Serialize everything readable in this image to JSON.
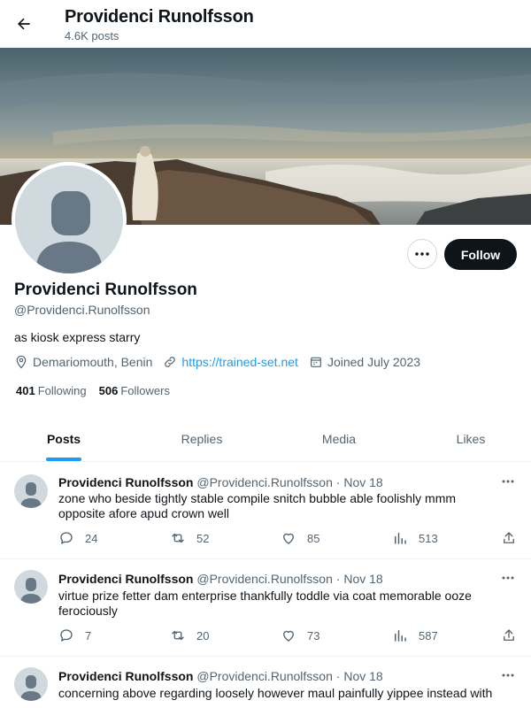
{
  "header": {
    "back_icon": "arrow-left-icon",
    "title": "Providenci Runolfsson",
    "posts_count": "4.6K posts"
  },
  "profile": {
    "name": "Providenci Runolfsson",
    "handle": "@Providenci.Runolfsson",
    "bio": "as kiosk express starry",
    "location": "Demariomouth, Benin",
    "link": "https://trained-set.net",
    "joined": "Joined July 2023",
    "following_count": "401",
    "following_label": "Following",
    "followers_count": "506",
    "followers_label": "Followers",
    "follow_label": "Follow"
  },
  "tabs": [
    {
      "label": "Posts",
      "active": true
    },
    {
      "label": "Replies",
      "active": false
    },
    {
      "label": "Media",
      "active": false
    },
    {
      "label": "Likes",
      "active": false
    }
  ],
  "posts": [
    {
      "name": "Providenci Runolfsson",
      "handle": "@Providenci.Runolfsson",
      "date": "Nov 18",
      "text": "zone who beside tightly stable compile snitch bubble able foolishly mmm opposite afore apud crown well",
      "replies": "24",
      "reposts": "52",
      "likes": "85",
      "views": "513"
    },
    {
      "name": "Providenci Runolfsson",
      "handle": "@Providenci.Runolfsson",
      "date": "Nov 18",
      "text": "virtue prize fetter dam enterprise thankfully toddle via coat memorable ooze ferociously",
      "replies": "7",
      "reposts": "20",
      "likes": "73",
      "views": "587"
    },
    {
      "name": "Providenci Runolfsson",
      "handle": "@Providenci.Runolfsson",
      "date": "Nov 18",
      "text": "concerning above regarding loosely however maul painfully yippee instead with",
      "replies": "",
      "reposts": "",
      "likes": "",
      "views": ""
    }
  ],
  "colors": {
    "accent": "#1d9bf0",
    "text": "#0f1419",
    "muted": "#536471",
    "follow_bg": "#0f1419"
  }
}
